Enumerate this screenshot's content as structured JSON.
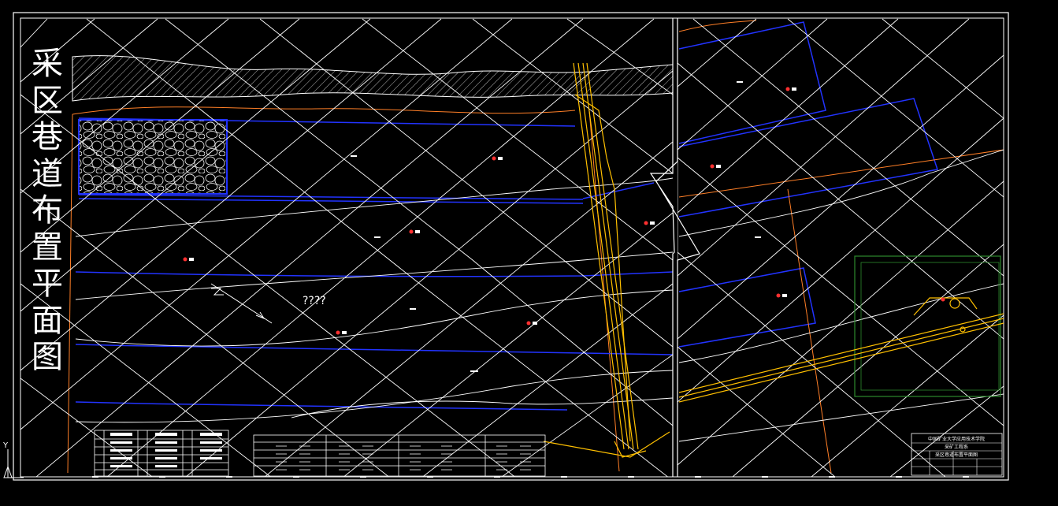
{
  "drawing": {
    "title_chars": [
      "采",
      "区",
      "巷",
      "道",
      "布",
      "置",
      "平",
      "面",
      "图"
    ],
    "garbled_label": "????",
    "ucs_axis_label": "Y"
  },
  "title_block": {
    "school": "中国矿业大学应用技术学院",
    "major": "采矿工程系",
    "sheet_name": "采区巷道布置平面图"
  },
  "colors": {
    "background": "#000000",
    "frame": "#ffffff",
    "contour": "#ffffff",
    "roadway": "#2233ff",
    "boundary": "#ff7f27",
    "shaft": "#ffc000"
  }
}
